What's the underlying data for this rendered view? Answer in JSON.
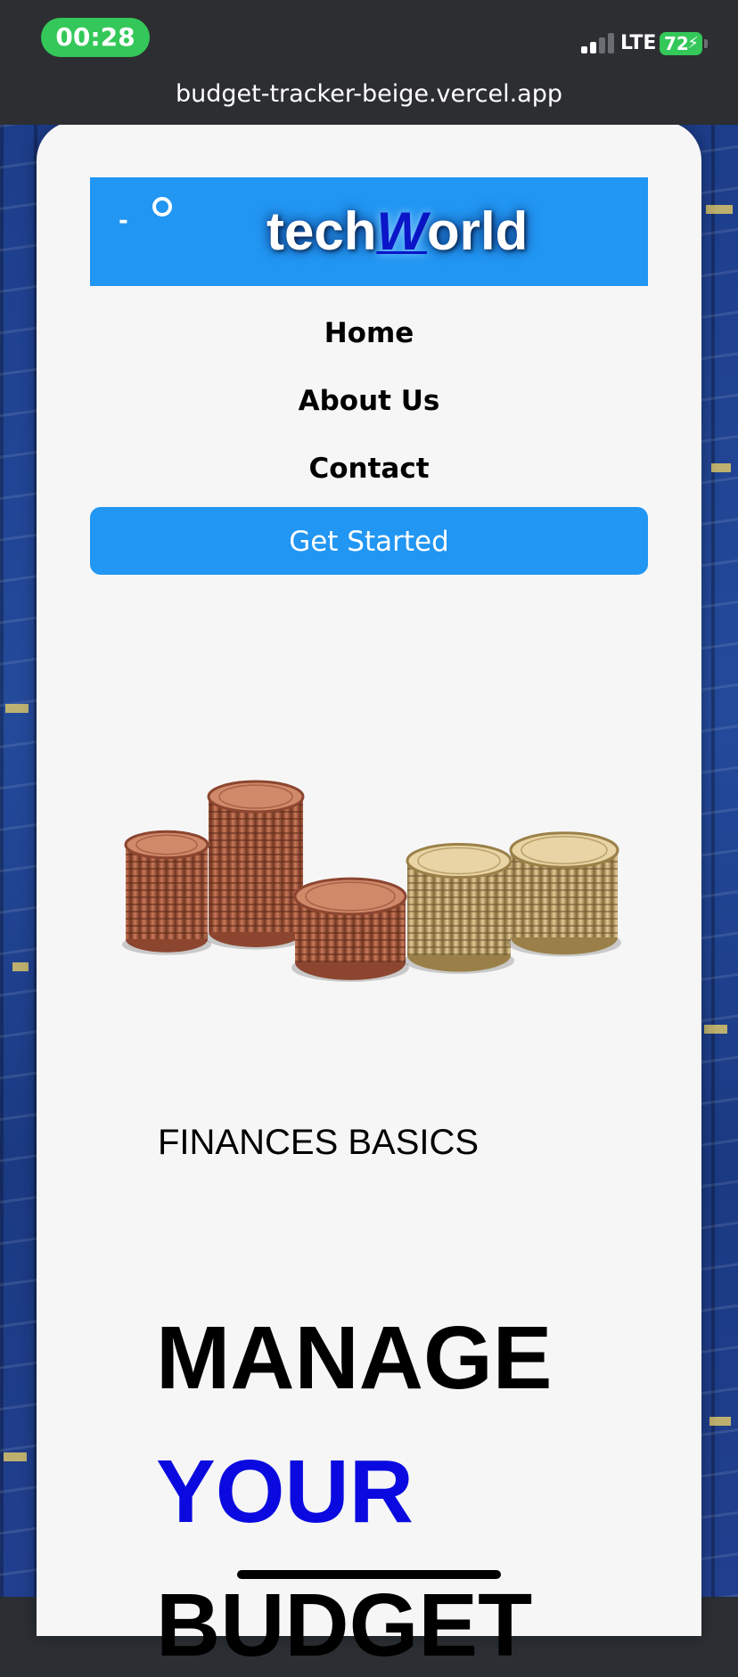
{
  "status_bar": {
    "time": "00:28",
    "network": "LTE",
    "battery": "72"
  },
  "browser": {
    "url": "budget-tracker-beige.vercel.app"
  },
  "brand": {
    "dash": "-",
    "logo_prefix": "tech",
    "logo_accent": "W",
    "logo_suffix": "orld"
  },
  "nav": {
    "items": [
      {
        "label": "Home"
      },
      {
        "label": "About Us"
      },
      {
        "label": "Contact"
      }
    ],
    "cta_label": "Get Started"
  },
  "hero": {
    "eyebrow": "FINANCES BASICS",
    "line1": "MANAGE",
    "line2": "YOUR",
    "line3": "BUDGET"
  },
  "colors": {
    "accent_blue": "#2196f3",
    "headline_blue": "#0a0ae0",
    "status_green": "#34c759"
  }
}
